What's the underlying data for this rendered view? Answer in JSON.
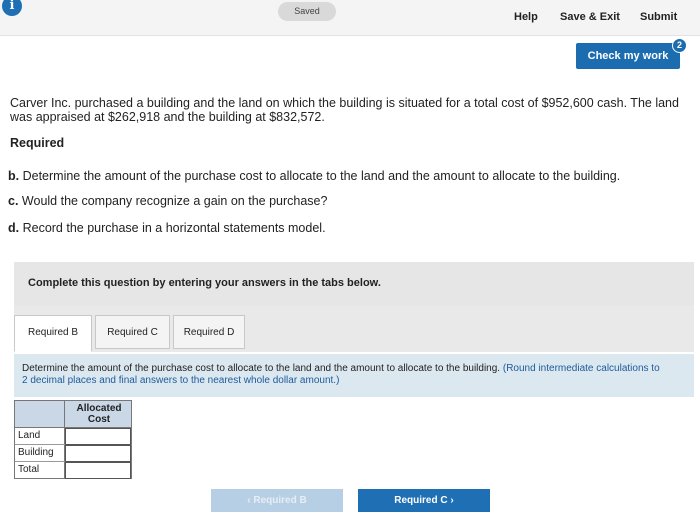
{
  "header": {
    "info_icon": "i",
    "saved_status": "Saved",
    "help_label": "Help",
    "save_exit_label": "Save & Exit",
    "submit_label": "Submit",
    "check_label": "Check my work",
    "check_badge": "2"
  },
  "question": {
    "text": "Carver Inc. purchased a building and the land on which the building is situated for a total cost of $952,600 cash. The land was appraised at $262,918 and the building at $832,572.",
    "required_heading": "Required",
    "items": [
      {
        "letter": "b.",
        "text": "Determine the amount of the purchase cost to allocate to the land and the amount to allocate to the building."
      },
      {
        "letter": "c.",
        "text": "Would the company recognize a gain on the purchase?"
      },
      {
        "letter": "d.",
        "text": "Record the purchase in a horizontal statements model."
      }
    ]
  },
  "panel": {
    "heading": "Complete this question by entering your answers in the tabs below.",
    "tabs": [
      {
        "label": "Required B"
      },
      {
        "label": "Required C"
      },
      {
        "label": "Required D"
      }
    ],
    "instruction": "Determine the amount of the purchase cost to allocate to the land and the amount to allocate to the building.",
    "instruction_note": "(Round intermediate calculations to 2 decimal places and final answers to the nearest whole dollar amount.)",
    "table": {
      "column_header": "Allocated Cost",
      "rows": [
        {
          "label": "Land",
          "value": ""
        },
        {
          "label": "Building",
          "value": ""
        },
        {
          "label": "Total",
          "value": ""
        }
      ]
    },
    "nav": {
      "prev_label": "Required B",
      "next_label": "Required C"
    }
  }
}
